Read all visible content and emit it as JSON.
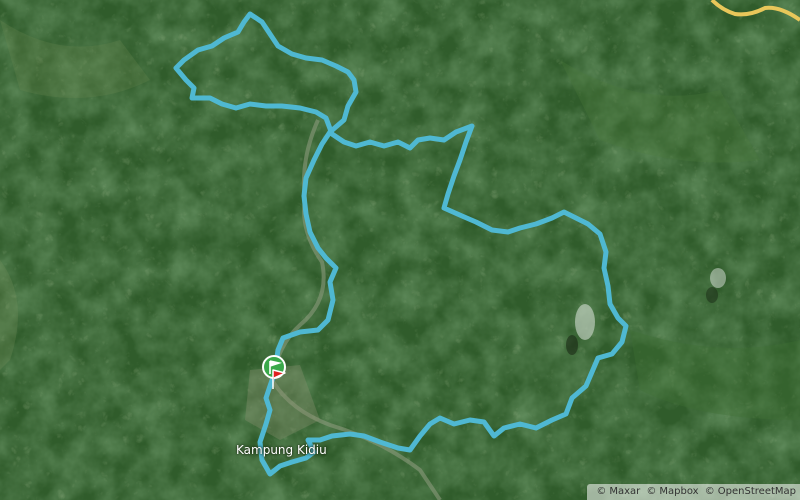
{
  "map": {
    "place_label": "Kampung Kidiu",
    "attribution": {
      "copyright_symbol": "©",
      "providers": [
        "Maxar",
        "Mapbox",
        "OpenStreetMap"
      ]
    },
    "route_color": "#4fb8d2",
    "road_color": "#e8c75a",
    "start_marker_color": "#3aa84a",
    "end_marker_color": "#e02020",
    "base_color": "#2f5a2a"
  }
}
